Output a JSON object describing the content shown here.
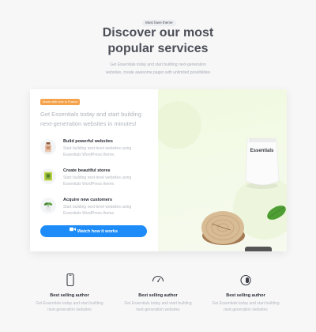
{
  "header": {
    "pill": "Most have theme",
    "title_line1": "Discover our most",
    "title_line2": "popular services",
    "subtitle_line1": "Get Essentials today and start building next-generation",
    "subtitle_line2": "websites, create awesome pages with unlimited possibilities"
  },
  "card": {
    "badge": "Made with love in France",
    "intro": "Get Essentials today and start building next-generation websites in minutes!",
    "features": [
      {
        "title": "Build powerful websites",
        "desc_line1": "Start building next-level websites using",
        "desc_line2": "Essentials WordPress theme.",
        "icon": "cosmetic-bottle-icon"
      },
      {
        "title": "Create beautiful stores",
        "desc_line1": "Start building next-level websites using",
        "desc_line2": "Essentials WordPress theme.",
        "icon": "plant-frame-icon"
      },
      {
        "title": "Acquire new customers",
        "desc_line1": "Start building next-level websites using",
        "desc_line2": "Essentials WordPress theme.",
        "icon": "potted-plant-icon"
      }
    ],
    "cta_label": "Watch how it works",
    "cta_icon": "video-camera-icon",
    "product_label": "Essentials"
  },
  "bottom": [
    {
      "icon": "smartphone-icon",
      "title": "Best selling author",
      "desc_line1": "Get Essentials today and start building",
      "desc_line2": "next-generation websites"
    },
    {
      "icon": "gauge-icon",
      "title": "Best selling author",
      "desc_line1": "Get Essentials today and start building",
      "desc_line2": "next-generation websites"
    },
    {
      "icon": "toggle-icon",
      "title": "Best selling author",
      "desc_line1": "Get Essentials today and start building",
      "desc_line2": "next-generation websites"
    }
  ],
  "colors": {
    "accent": "#1d8cf8",
    "badge": "#f5a24b",
    "heading": "#4c4f57",
    "muted": "#b3b7be",
    "panel": "#f1f9e0"
  }
}
